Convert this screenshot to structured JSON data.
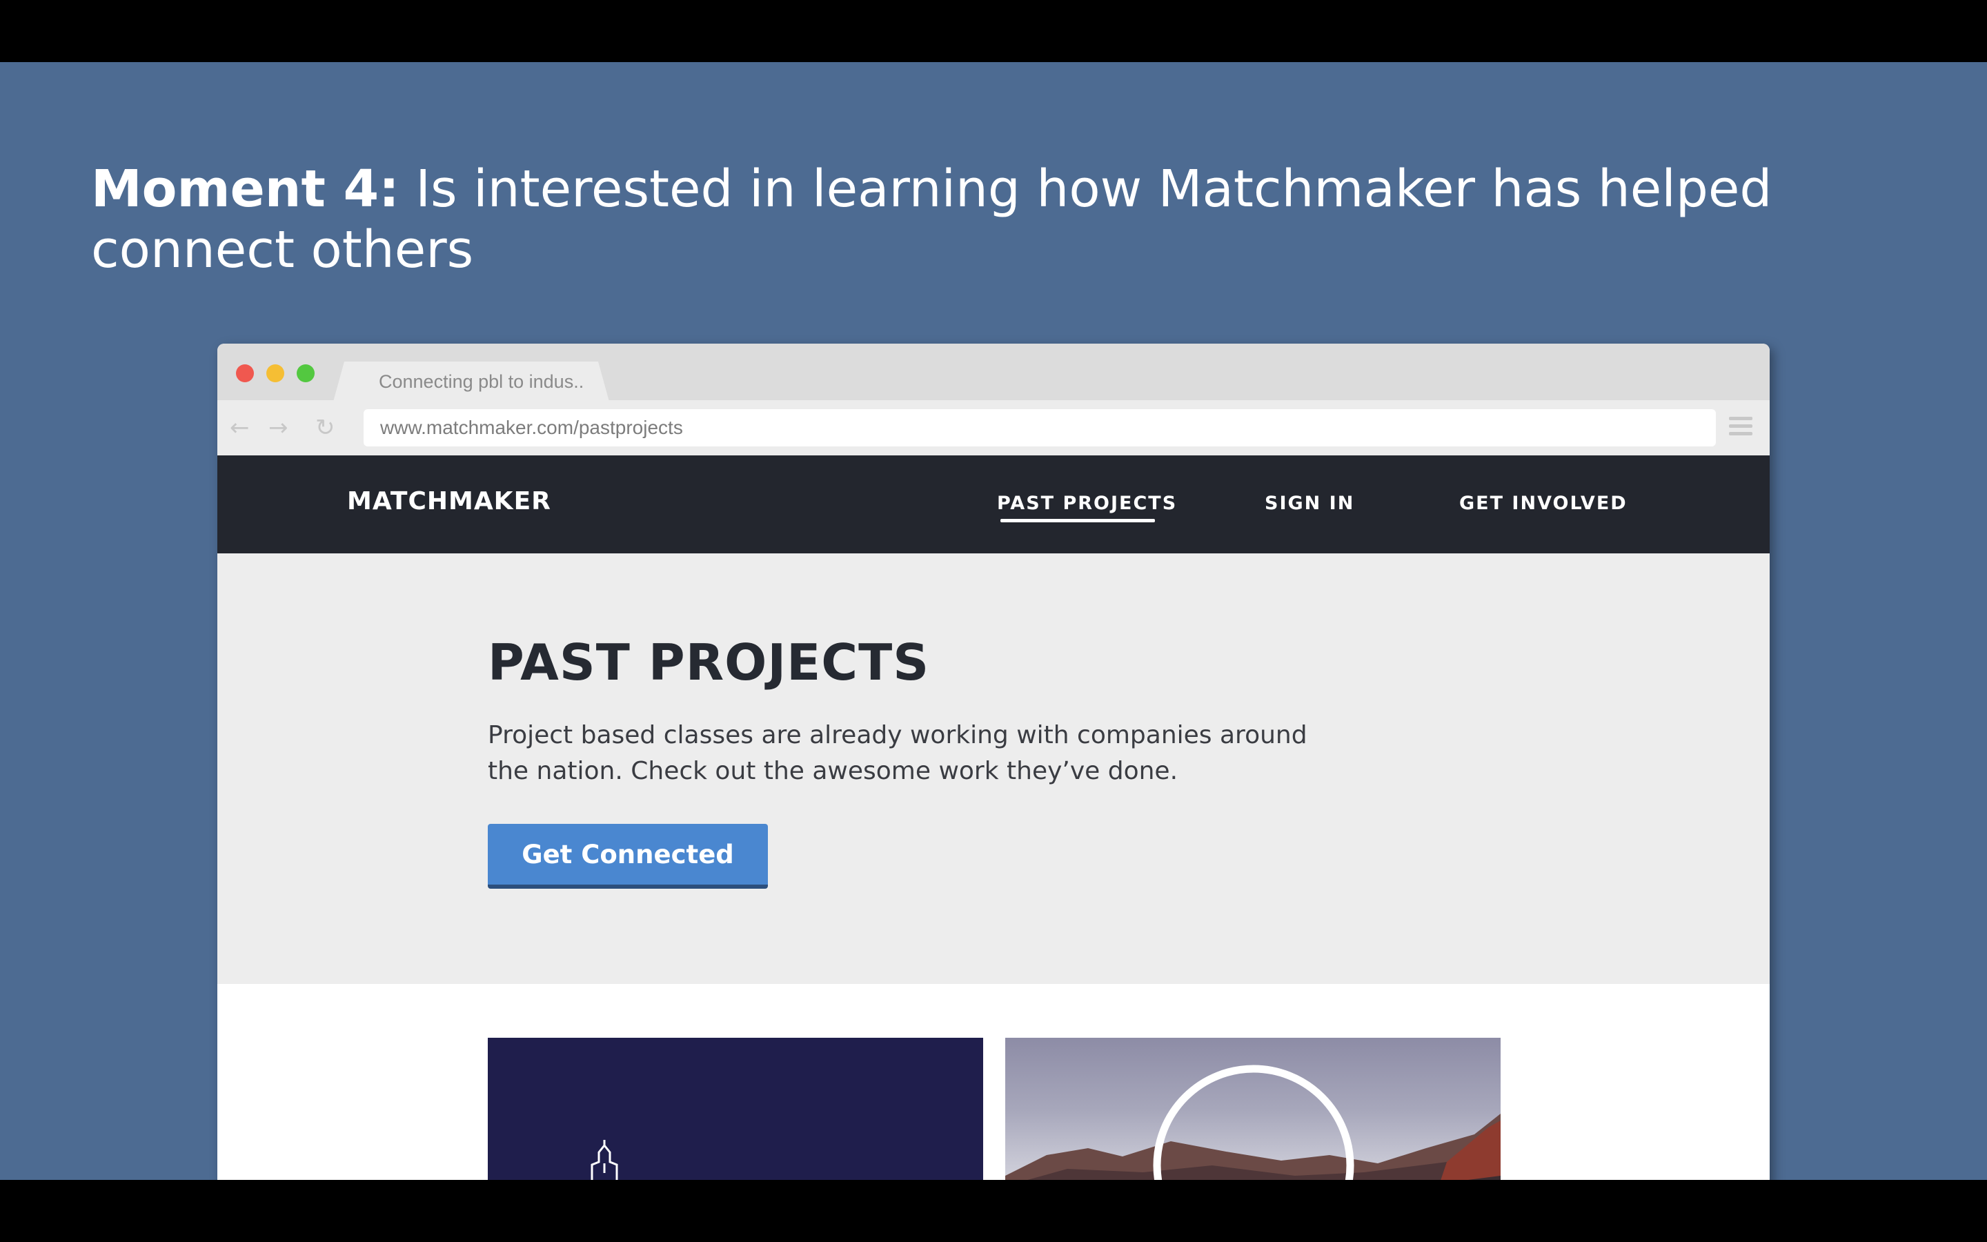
{
  "slide": {
    "title_bold": "Moment 4:",
    "title_rest": " Is interested in learning how Matchmaker has helped connect others"
  },
  "browser": {
    "tab_title": "Connecting pbl to indus..",
    "url": "www.matchmaker.com/pastprojects",
    "back_glyph": "←",
    "forward_glyph": "→",
    "reload_glyph": "↻"
  },
  "site": {
    "brand": "MATCHMAKER",
    "nav": {
      "past_projects": "PAST PROJECTS",
      "sign_in": "SIGN IN",
      "get_involved": "GET INVOLVED",
      "active": "past_projects"
    },
    "hero": {
      "title": "PAST PROJECTS",
      "description": "Project based classes are already working with companies around the nation. Check out the awesome work they’ve done.",
      "cta_label": "Get Connected"
    }
  },
  "icons": {
    "traffic_lights": [
      "close",
      "minimize",
      "zoom"
    ],
    "card_1": "building-icon",
    "card_2": "circle-outline-icon",
    "browser_menu": "hamburger-menu-icon"
  },
  "colors": {
    "slide_background": "#4d6b92",
    "nav_background": "#23262e",
    "cta": "#4a87d0",
    "card_dark": "#1f1e4c"
  }
}
